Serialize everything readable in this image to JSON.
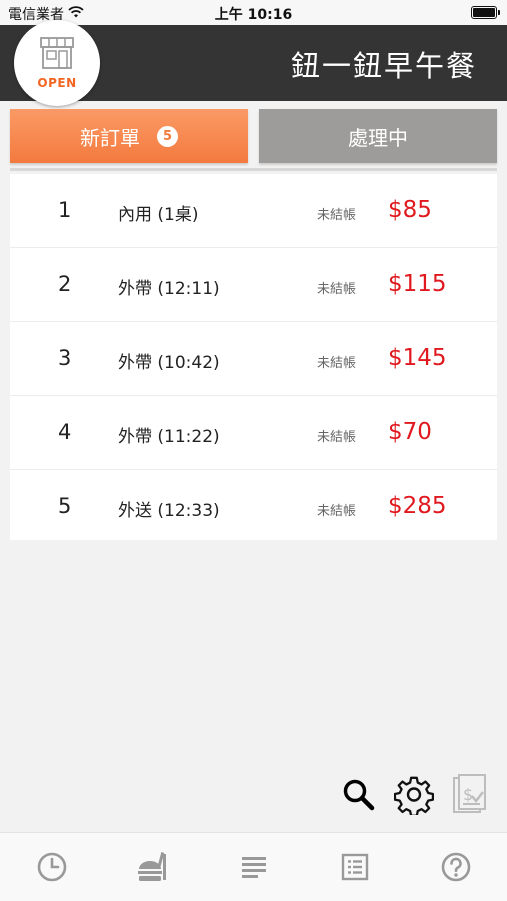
{
  "status_bar": {
    "carrier": "電信業者",
    "time": "上午 10:16"
  },
  "header": {
    "logo_text": "OPEN",
    "store_name": "鈕一鈕早午餐"
  },
  "tabs": {
    "new_orders": {
      "label": "新訂單",
      "count": "5"
    },
    "processing": {
      "label": "處理中"
    }
  },
  "orders": [
    {
      "number": "1",
      "type": "內用 (1桌)",
      "status": "未結帳",
      "price": "$85"
    },
    {
      "number": "2",
      "type": "外帶 (12:11)",
      "status": "未結帳",
      "price": "$115"
    },
    {
      "number": "3",
      "type": "外帶 (10:42)",
      "status": "未結帳",
      "price": "$145"
    },
    {
      "number": "4",
      "type": "外帶 (11:22)",
      "status": "未結帳",
      "price": "$70"
    },
    {
      "number": "5",
      "type": "外送 (12:33)",
      "status": "未結帳",
      "price": "$285"
    }
  ],
  "tools": [
    "search-icon",
    "gear-icon",
    "receipt-check-icon"
  ],
  "bottom_nav": [
    "clock-icon",
    "meal-icon",
    "list-icon",
    "checklist-icon",
    "help-icon"
  ],
  "colors": {
    "header_bg": "#343434",
    "accent_orange": "#f37a3e",
    "tab_inactive": "#9d9c9a",
    "price_red": "#e0191f"
  }
}
